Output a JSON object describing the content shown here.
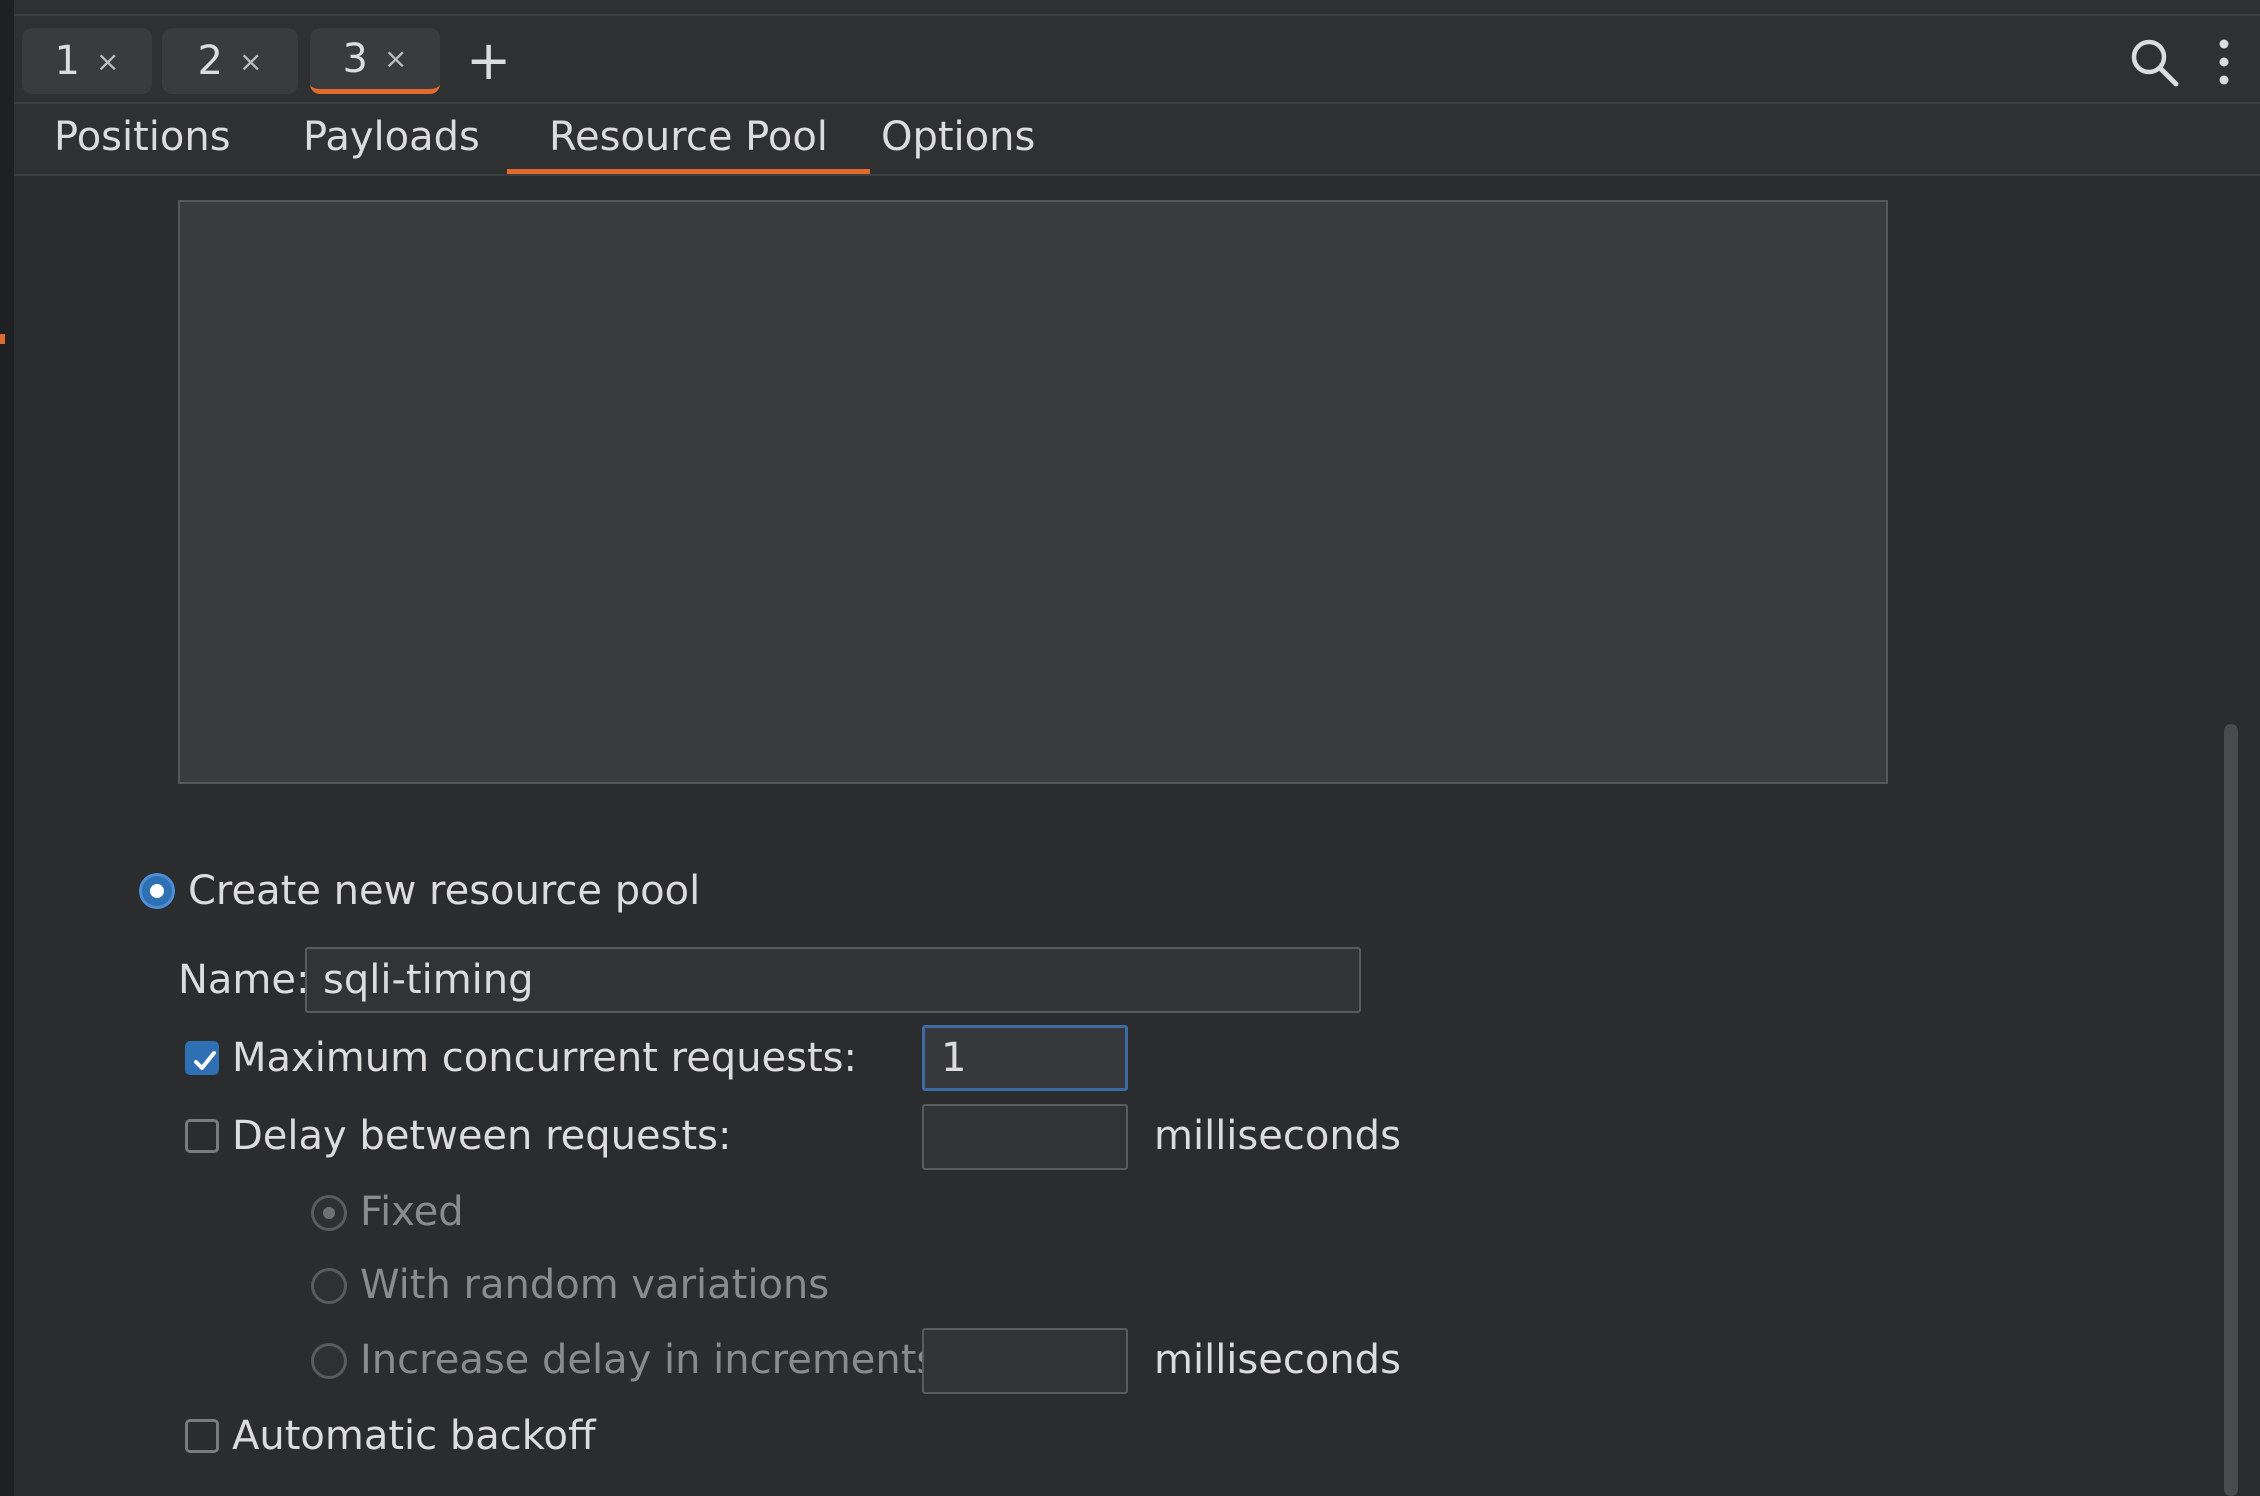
{
  "tabs": [
    {
      "label": "1",
      "close": "×"
    },
    {
      "label": "2",
      "close": "×"
    },
    {
      "label": "3",
      "close": "×"
    }
  ],
  "active_tab": "3",
  "add_tab": "+",
  "subtabs": [
    "Positions",
    "Payloads",
    "Resource Pool",
    "Options"
  ],
  "active_subtab": "Resource Pool",
  "resource_pool": {
    "create_new_label": "Create new resource pool",
    "name_label": "Name:",
    "name_value": "sqli-timing",
    "max_concurrent_label": "Maximum concurrent requests:",
    "max_concurrent_checked": true,
    "max_concurrent_value": "1",
    "delay_label": "Delay between requests:",
    "delay_checked": false,
    "delay_value": "",
    "delay_unit": "milliseconds",
    "fixed_label": "Fixed",
    "random_label": "With random variations",
    "increase_label": "Increase delay in increments of",
    "increase_value": "",
    "increase_unit": "milliseconds",
    "backoff_label": "Automatic backoff",
    "backoff_checked": false
  },
  "colors": {
    "accent": "#e06b2c",
    "selection": "#2f6fb3",
    "background": "#2b2c2e"
  }
}
